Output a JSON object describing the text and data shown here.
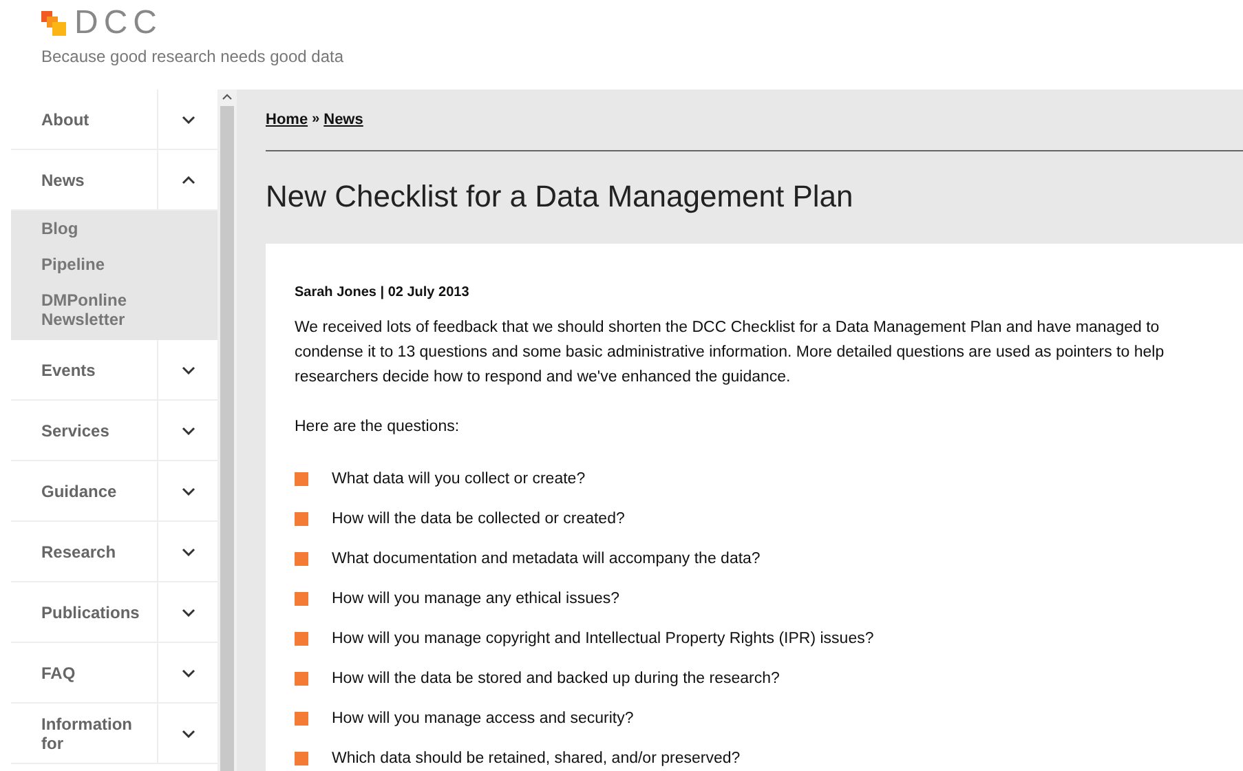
{
  "header": {
    "logo": "DCC",
    "tagline": "Because good research needs good data"
  },
  "sidebar": {
    "items": [
      {
        "label": "About",
        "expanded": false
      },
      {
        "label": "News",
        "expanded": true,
        "children": [
          {
            "label": "Blog"
          },
          {
            "label": "Pipeline"
          },
          {
            "label": "DMPonline Newsletter"
          }
        ]
      },
      {
        "label": "Events",
        "expanded": false
      },
      {
        "label": "Services",
        "expanded": false
      },
      {
        "label": "Guidance",
        "expanded": false
      },
      {
        "label": "Research",
        "expanded": false
      },
      {
        "label": "Publications",
        "expanded": false
      },
      {
        "label": "FAQ",
        "expanded": false
      },
      {
        "label": "Information for",
        "expanded": false
      }
    ]
  },
  "breadcrumb": [
    {
      "label": "Home"
    },
    {
      "label": "News"
    }
  ],
  "breadcrumb_separator": "»",
  "article": {
    "title": "New Checklist for a Data Management Plan",
    "byline": "Sarah Jones | 02 July 2013",
    "paragraphs": [
      "We received lots of feedback that we should shorten the DCC Checklist for a Data Management Plan and have managed to condense it to 13 questions and some basic administrative information. More detailed questions are used as pointers to help researchers decide how to respond and we've enhanced the guidance.",
      "Here are the questions:"
    ],
    "questions": [
      "What data will you collect or create?",
      "How will the data be collected or created?",
      "What documentation and metadata will accompany the data?",
      "How will you manage any ethical issues?",
      "How will you manage copyright and Intellectual Property Rights (IPR) issues?",
      "How will the data be stored and backed up during the research?",
      "How will you manage access and security?",
      "Which data should be retained, shared, and/or preserved?"
    ]
  }
}
